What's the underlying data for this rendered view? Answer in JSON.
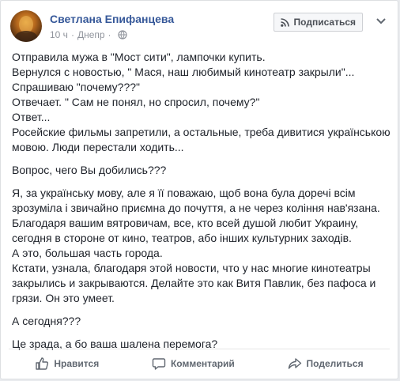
{
  "post": {
    "author": "Светлана Епифанцева",
    "time": "10 ч",
    "separator": "·",
    "location": "Днепр",
    "subscribe_label": "Подписаться",
    "paragraphs": [
      {
        "lines": [
          "Отправила мужа в \"Мост сити\", лампочки купить.",
          "Вернулся с новостью, \" Мася, наш любимый кинотеатр закрыли\"...",
          "Спрашиваю \"почему???\"",
          "Отвечает. \" Сам не понял, но спросил, почему?\"",
          "Ответ...",
          "Росейские фильмы запретили, а остальные, треба дивитися українською",
          "мовою. Люди перестали ходить..."
        ]
      },
      {
        "lines": [
          "Вопрос, чего Вы добились???"
        ]
      },
      {
        "lines": [
          "Я, за українську мову, але я її поважаю, щоб вона була доречі всім",
          "зрозуміла і звичайно приємна до почуття, а не через коління нав'язана.",
          "Благодаря вашим вятровичам, все, кто всей душой любит Украину,",
          "сегодня в стороне от кино, театров, або інших культурних заходів.",
          "А это, большая часть города.",
          "Кстати, узнала, благодаря этой новости, что у нас многие кинотеатры",
          "закрылись и закрываются. Делайте это как Витя Павлик, без пафоса и",
          "грязи. Он это умеет."
        ]
      },
      {
        "lines": [
          "А сегодня???"
        ]
      },
      {
        "lines": [
          "Це зрада, а бо ваша шалена перемога?"
        ]
      }
    ]
  },
  "actions": {
    "like_label": "Нравится",
    "comment_label": "Комментарий",
    "share_label": "Поделиться"
  },
  "icons": {
    "subscribe": "rss-icon",
    "privacy": "globe-icon",
    "menu": "chevron-down-icon",
    "like": "thumbs-up-icon",
    "comment": "comment-bubble-icon",
    "share": "share-arrow-icon"
  },
  "colors": {
    "author_link": "#365899",
    "meta": "#90949c",
    "text": "#1d2129",
    "action": "#606770"
  }
}
